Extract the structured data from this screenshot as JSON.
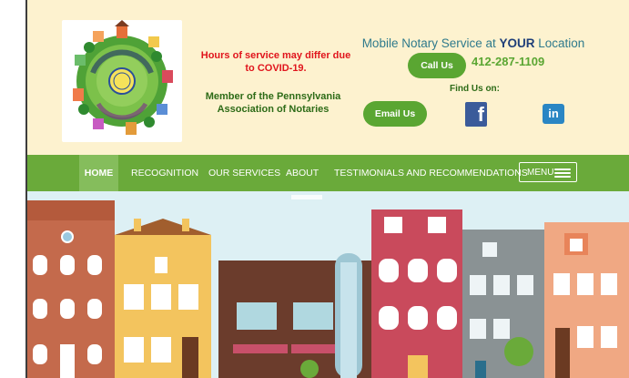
{
  "header": {
    "logo_icon": "notary-neighborhood-seal-logo",
    "notice": "Hours of service may differ due to COVID-19.",
    "member": "Member of the Pennsylvania Association of Notaries",
    "tagline_prefix": "Mobile Notary Service at ",
    "tagline_emphasis": "YOUR",
    "tagline_suffix": " Location",
    "call_label": "Call Us",
    "phone": "412-287-1109",
    "find_us": "Find Us on:",
    "email_label": "Email Us",
    "facebook_icon": "facebook-icon",
    "linkedin_icon": "linkedin-icon",
    "linkedin_glyph": "in",
    "facebook_glyph": "f"
  },
  "nav": {
    "items": [
      "HOME",
      "RECOGNITION",
      "OUR SERVICES",
      "ABOUT",
      "TESTIMONIALS AND RECOMMENDATIONS"
    ],
    "active": "HOME",
    "menu_label": "MENU",
    "menu_icon": "hamburger-icon"
  },
  "hero": {
    "illustration": "townhouse-street-illustration"
  },
  "colors": {
    "header_bg": "#fdf2cf",
    "nav_bg": "#6aaa3a",
    "button_green": "#5aa632",
    "notice_red": "#e0141c",
    "member_green": "#2d6b17"
  }
}
